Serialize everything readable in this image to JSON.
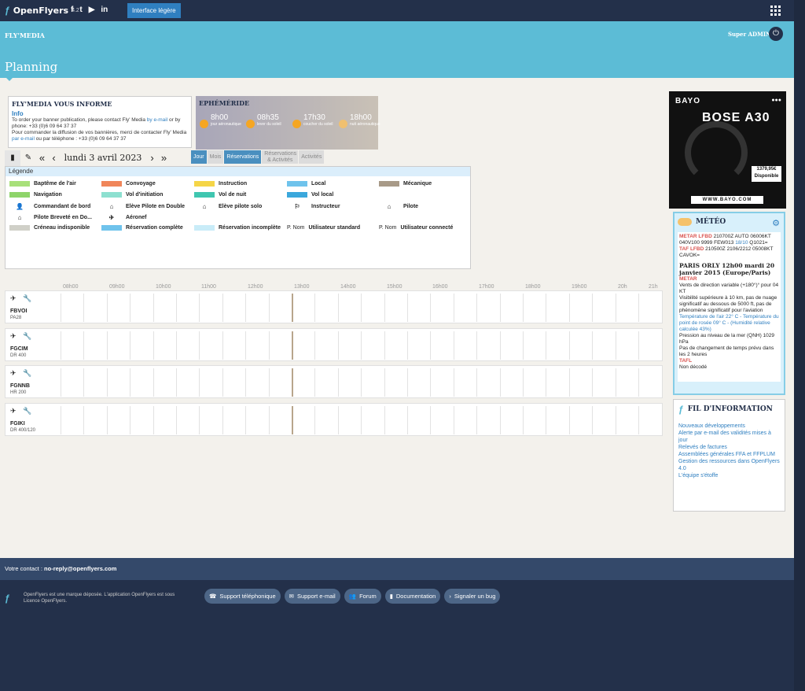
{
  "topbar": {
    "brand": "OpenFlyers",
    "version": "4.2",
    "social": [
      "f",
      "t",
      "▶",
      "in"
    ],
    "light_button": "Interface légère"
  },
  "header": {
    "org": "FLY'MEDIA",
    "user": "Super ADMIN",
    "page_title": "Planning"
  },
  "info": {
    "title": "FLY'MEDIA VOUS INFORME",
    "subtitle": "Info",
    "en_text": "To order your banner publication, please contact Fly' Media ",
    "en_link": "by e-mail",
    "en_or": " or by phone: +33 (0)6 09 64 37 37",
    "fr_text": "Pour commander la diffusion de vos bannières, merci de contacter Fly' Media ",
    "fr_link": "par e-mail",
    "fr_or": " ou par téléphone : +33 (0)6 09 64 37 37"
  },
  "ephemeride": {
    "title": "EPHÉMÉRIDE",
    "items": [
      {
        "time": "8h00",
        "label": "jour aéronautique"
      },
      {
        "time": "08h35",
        "label": "lever du soleil"
      },
      {
        "time": "17h30",
        "label": "coucher du soleil"
      },
      {
        "time": "18h00",
        "label": "nuit aéronautique"
      }
    ]
  },
  "toolbar": {
    "date": "lundi 3 avril 2023",
    "tabs": [
      "Jour",
      "Mois",
      "Réservations",
      "Réservations & Activités",
      "Activités"
    ]
  },
  "legend": {
    "title": "Légende",
    "items": [
      {
        "label": "Baptême de l'air",
        "color": "#a8e07a"
      },
      {
        "label": "Convoyage",
        "color": "#f0865a"
      },
      {
        "label": "Instruction",
        "color": "#f5d547"
      },
      {
        "label": "Local",
        "color": "#6fc3ec"
      },
      {
        "label": "Mécanique",
        "color": "#a89a88"
      },
      {
        "label": "Navigation",
        "color": "#8ed46a"
      },
      {
        "label": "Vol d'initiation",
        "color": "#8de0d0"
      },
      {
        "label": "Vol de nuit",
        "color": "#3fc6b0"
      },
      {
        "label": "Vol local",
        "color": "#3ba8dc"
      },
      {
        "label": "Commandant de bord",
        "icon": "person-icon"
      },
      {
        "label": "Elève Pilote en Double",
        "icon": "student-double-icon"
      },
      {
        "label": "Elève pilote solo",
        "icon": "student-solo-icon"
      },
      {
        "label": "Instructeur",
        "icon": "instructor-icon"
      },
      {
        "label": "Pilote",
        "icon": "pilot-icon"
      },
      {
        "label": "Pilote Breveté en Do...",
        "icon": "licensed-pilot-icon"
      },
      {
        "label": "Aéronef",
        "icon": "aircraft-icon"
      },
      {
        "label": "Créneau indisponible",
        "color": "#d0d0c8"
      },
      {
        "label": "Réservation complète",
        "color": "#6fc3ec"
      },
      {
        "label": "Réservation incomplète",
        "color": "#c9ecf8"
      },
      {
        "label": "Utilisateur standard",
        "prefix": "P. Nom"
      },
      {
        "label": "Utilisateur connecté",
        "prefix": "P. Nom"
      }
    ]
  },
  "timeline": {
    "hours": [
      "08h00",
      "09h00",
      "10h00",
      "11h00",
      "12h00",
      "13h00",
      "14h00",
      "15h00",
      "16h00",
      "17h00",
      "18h00",
      "19h00",
      "20h",
      "21h"
    ],
    "aircraft": [
      {
        "reg": "FBVOI",
        "type": "PA28"
      },
      {
        "reg": "FGCIM",
        "type": "DR 400"
      },
      {
        "reg": "FGNNB",
        "type": "HR 200"
      },
      {
        "reg": "FGIKI",
        "type": "DR 400/120"
      }
    ]
  },
  "ad": {
    "brand": "BAYO",
    "product": "BOSE A30",
    "price": "1379,95€",
    "availability": "Disponible",
    "url": "WWW.BAYO.COM"
  },
  "meteo": {
    "title": "MÉTÉO",
    "metar_label": "METAR LFBD",
    "metar_text": " 210700Z AUTO 06006KT 040V100 9999 FEW013 ",
    "metar_tail": "18/10",
    "metar_q": " Q1021=",
    "taf_label": "TAF LFBD",
    "taf_text": " 210500Z 2106/2212 05008KT CAVOK=",
    "station": "PARIS ORLY 12h00 mardi 20 janvier 2015 (Europe/Paris)",
    "metar": "METAR",
    "lines": [
      "Vents de direction variable (+180°)° pour 04 KT",
      "Visibilité supérieure à 10 km, pas de nuage significatif au dessous de 5000 ft, pas de phénomène significatif pour l'aviation"
    ],
    "temp": "Température de l'air 22° C - Température du point de rosée 09° C - (Humidité relative calculée 43%)",
    "lines2": [
      "Pression au niveau de la mer (QNH) 1029 hPa",
      "Pas de changement de temps prévu dans les 2 heures"
    ],
    "tafl": "TAFL",
    "decode": "Non décodé"
  },
  "fil": {
    "title": "FIL D'INFORMATION",
    "links": [
      "Nouveaux développements",
      "Alerte par e-mail des validités mises à jour",
      "Relevés de factures",
      "Assemblées générales FFA et FFPLUM",
      "Gestion des ressources dans OpenFlyers 4.0",
      "L'équipe s'étoffe"
    ]
  },
  "footer": {
    "contact_label": "Votre contact : ",
    "contact_email": "no-reply@openflyers.com",
    "legal": "OpenFlyers est une marque déposée. L'application OpenFlyers est sous Licence OpenFlyers.",
    "buttons": [
      "Support téléphonique",
      "Support e-mail",
      "Forum",
      "Documentation",
      "Signaler un bug"
    ]
  }
}
